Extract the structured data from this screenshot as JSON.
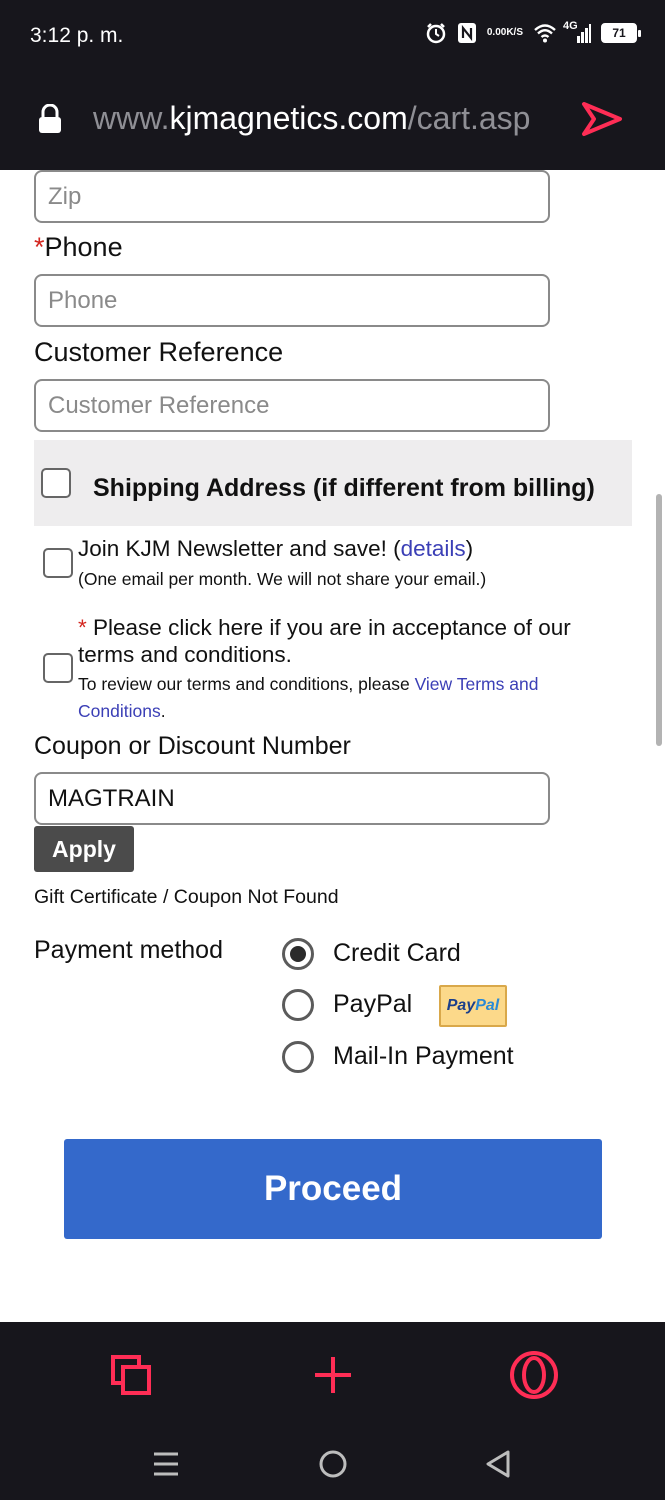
{
  "status_bar": {
    "time": "3:12 p. m.",
    "net_speed_top": "0.00",
    "net_speed_bottom": "K/S",
    "network": "4G",
    "battery": "71",
    "icons": [
      "alarm-icon",
      "nfc-icon",
      "wifi-icon",
      "signal-icon",
      "battery-icon"
    ]
  },
  "browser": {
    "url_prefix": "www.",
    "url_host": "kjmagnetics.com",
    "url_path": "/cart.asp",
    "accent_color": "#ff2d55"
  },
  "form": {
    "zip": {
      "placeholder": "Zip",
      "value": ""
    },
    "phone": {
      "required_marker": "*",
      "label": "Phone",
      "placeholder": "Phone",
      "value": ""
    },
    "customer_reference": {
      "label": "Customer Reference",
      "placeholder": "Customer Reference",
      "value": ""
    },
    "shipping_address": {
      "label": "Shipping Address (if different from billing)",
      "checked": false
    },
    "newsletter": {
      "label_before": "Join KJM Newsletter and save! (",
      "link": "details",
      "label_after": ")",
      "note": "(One email per month. We will not share your email.)",
      "checked": false
    },
    "terms": {
      "required_marker": "*",
      "label_line1": " Please click here if you are in acceptance of our",
      "label_line2": "terms and conditions.",
      "note_before": "To review our terms and conditions, please ",
      "link_line1": "View Terms and",
      "link_line2": "Conditions",
      "note_after": ".",
      "checked": false
    },
    "coupon": {
      "label": "Coupon or Discount Number",
      "value": "MAGTRAIN",
      "apply_label": "Apply",
      "message": "Gift Certificate / Coupon Not Found"
    },
    "payment": {
      "label": "Payment method",
      "options": [
        {
          "label": "Credit Card",
          "selected": true
        },
        {
          "label": "PayPal",
          "selected": false,
          "badge_pay": "Pay",
          "badge_pal": "Pal"
        },
        {
          "label": "Mail-In Payment",
          "selected": false
        }
      ]
    },
    "proceed_label": "Proceed",
    "primary_color": "#3469cb"
  },
  "bottom_bar": {
    "icons": [
      "tabs-icon",
      "new-tab-plus-icon",
      "opera-menu-icon"
    ]
  },
  "system_nav": {
    "icons": [
      "recents-menu-icon",
      "home-circle-icon",
      "back-triangle-icon"
    ]
  }
}
